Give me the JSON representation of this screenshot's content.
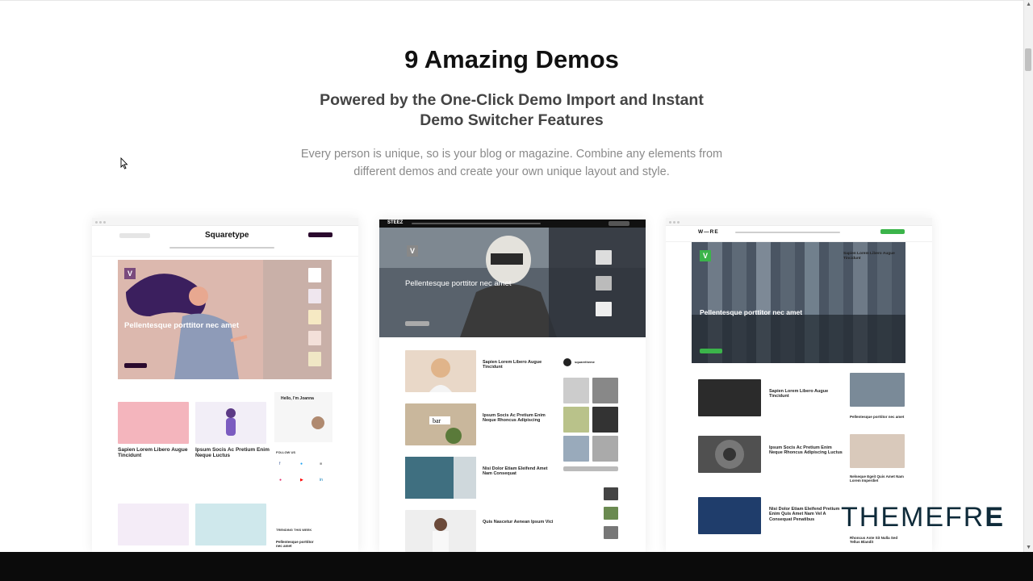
{
  "heading": {
    "title": "9 Amazing Demos",
    "subtitle": "Powered by the One-Click Demo Import and Instant Demo Switcher Features",
    "description": "Every person is unique, so is your blog or magazine. Combine any elements from different demos and create your own unique layout and style."
  },
  "demos": [
    {
      "logo": "Squaretype",
      "hero_title": "Pellentesque porttitor nec amet",
      "hero_badge": "V",
      "posts": [
        "Sapien Lorem Libero Augue Tincidunt",
        "Ipsum Socis Ac Pretium Enim Neque Luctus"
      ],
      "sidebar_title": "Hello, I'm Joanna",
      "follow_label": "FOLLOW US",
      "trending_label": "TRENDING THIS WEEK",
      "trending_item": "Pellentesque porttitor nec amet",
      "colors": {
        "accent": "#2b0a2e",
        "hero_bg": "#d8b8b0"
      }
    },
    {
      "logo": "STEEZ",
      "hero_title": "Pellentesque porttitor nec amet",
      "hero_badge": "V",
      "posts": [
        "Sapien Lorem Libero Augue Tincidunt",
        "Ipsum Socis Ac Pretium Enim Neque Rhoncus Adipiscing",
        "Nisi Dolor Etiam Eleifend Amet Nam Consequat",
        "Quis Nascetur Aenean Ipsum Vici"
      ],
      "profile_name": "squaretheme",
      "colors": {
        "accent": "#111111"
      }
    },
    {
      "logo": "W—RE",
      "hero_title": "Pellentesque porttitor nec amet",
      "hero_badge": "V",
      "posts": [
        "Sapien Lorem Libero Augue Tincidunt",
        "Ipsum Socis Ac Pretium Enim Neque Rhoncus Adipiscing Luctus",
        "Nisi Dolor Etiam Eleifend Pretium Enim Quis Amet Nam Vel A Consequat Penatibus"
      ],
      "side_posts": [
        "Sapien Lorem Libero Augue Tincidunt",
        "Pellentesque porttitor nec amet",
        "Nelseque Egeit Quis Amet Nam Lorem Imperdiet",
        "Rhoncus Ante Sit Nulla Sed Tellus Blandit"
      ],
      "colors": {
        "accent": "#3bb44a"
      }
    }
  ],
  "watermark": {
    "text": "THEMEFR",
    "last_letter": "E"
  }
}
